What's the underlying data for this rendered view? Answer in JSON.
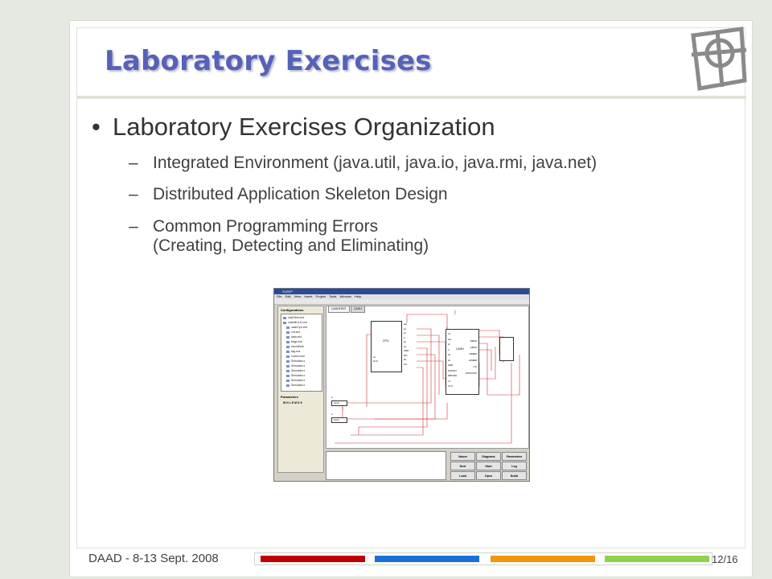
{
  "slide": {
    "title": "Laboratory Exercises",
    "bullet": "Laboratory Exercises Organization",
    "bullet_marker": "•",
    "sub_marker": "–",
    "subitems": [
      {
        "text": "Integrated Environment (java.util, java.io, java.rmi, java.net)"
      },
      {
        "text": "Distributed Application Skeleton Design"
      },
      {
        "text": "Common Programming Errors",
        "continuation": "(Creating, Detecting and Eliminating)"
      }
    ],
    "footer": "DAAD - 8-13 Sept. 2008",
    "page_number": "12/16",
    "bar_colors": [
      "#c00000",
      "#1a6fd6",
      "#f0960f",
      "#92d050"
    ]
  },
  "screenshot": {
    "window_title": "SLEEP",
    "menu": [
      "File",
      "Edit",
      "View",
      "Insert",
      "Project",
      "Tools",
      "Window",
      "Help"
    ],
    "config_label": "Configurations",
    "tree_items": [
      "cashTest.xml",
      "cashMULD.xml",
      "cashCpu.xml",
      "cnt.xml",
      "data.xml",
      "flags.xml",
      "memWrite",
      "tag.xml",
      "control.xml",
      "Simulator.x",
      "Simulator.x",
      "Simulator.x",
      "Simulator.x",
      "Simulator.x",
      "Simulator.x"
    ],
    "params_label": "Parameters",
    "params_value": "W  N L E M D S",
    "tabs": [
      "CASHTEST",
      "CASH"
    ],
    "blocks": {
      "cpu": {
        "label": "CPU",
        "pins_in": [
          "rd",
          "CLK"
        ],
        "pins_out": [
          "adr",
          "wr",
          "pf",
          "it",
          "ch",
          "wt",
          "ADR",
          "DO",
          "DI",
          "CC"
        ]
      },
      "cash": {
        "label": "CASH",
        "pins_in": [
          "rd",
          "wd",
          "pf",
          "it",
          "ch",
          "wt",
          "ADR",
          "DATAIN",
          "DBUSIN",
          "rd",
          "CLK"
        ],
        "pins_out": [
          "DBUS",
          "ABUS",
          "rdMEM",
          "wrMEM",
          "CC",
          "DATAOPU"
        ]
      }
    },
    "inputs": [
      "input",
      "input"
    ],
    "input_numbers": [
      "2",
      "4"
    ],
    "buttons": [
      [
        "Values",
        "Diagrams",
        "Parameters"
      ],
      [
        "Next",
        "Start",
        "Log"
      ],
      [
        "Load",
        "Open",
        "Build"
      ]
    ]
  }
}
